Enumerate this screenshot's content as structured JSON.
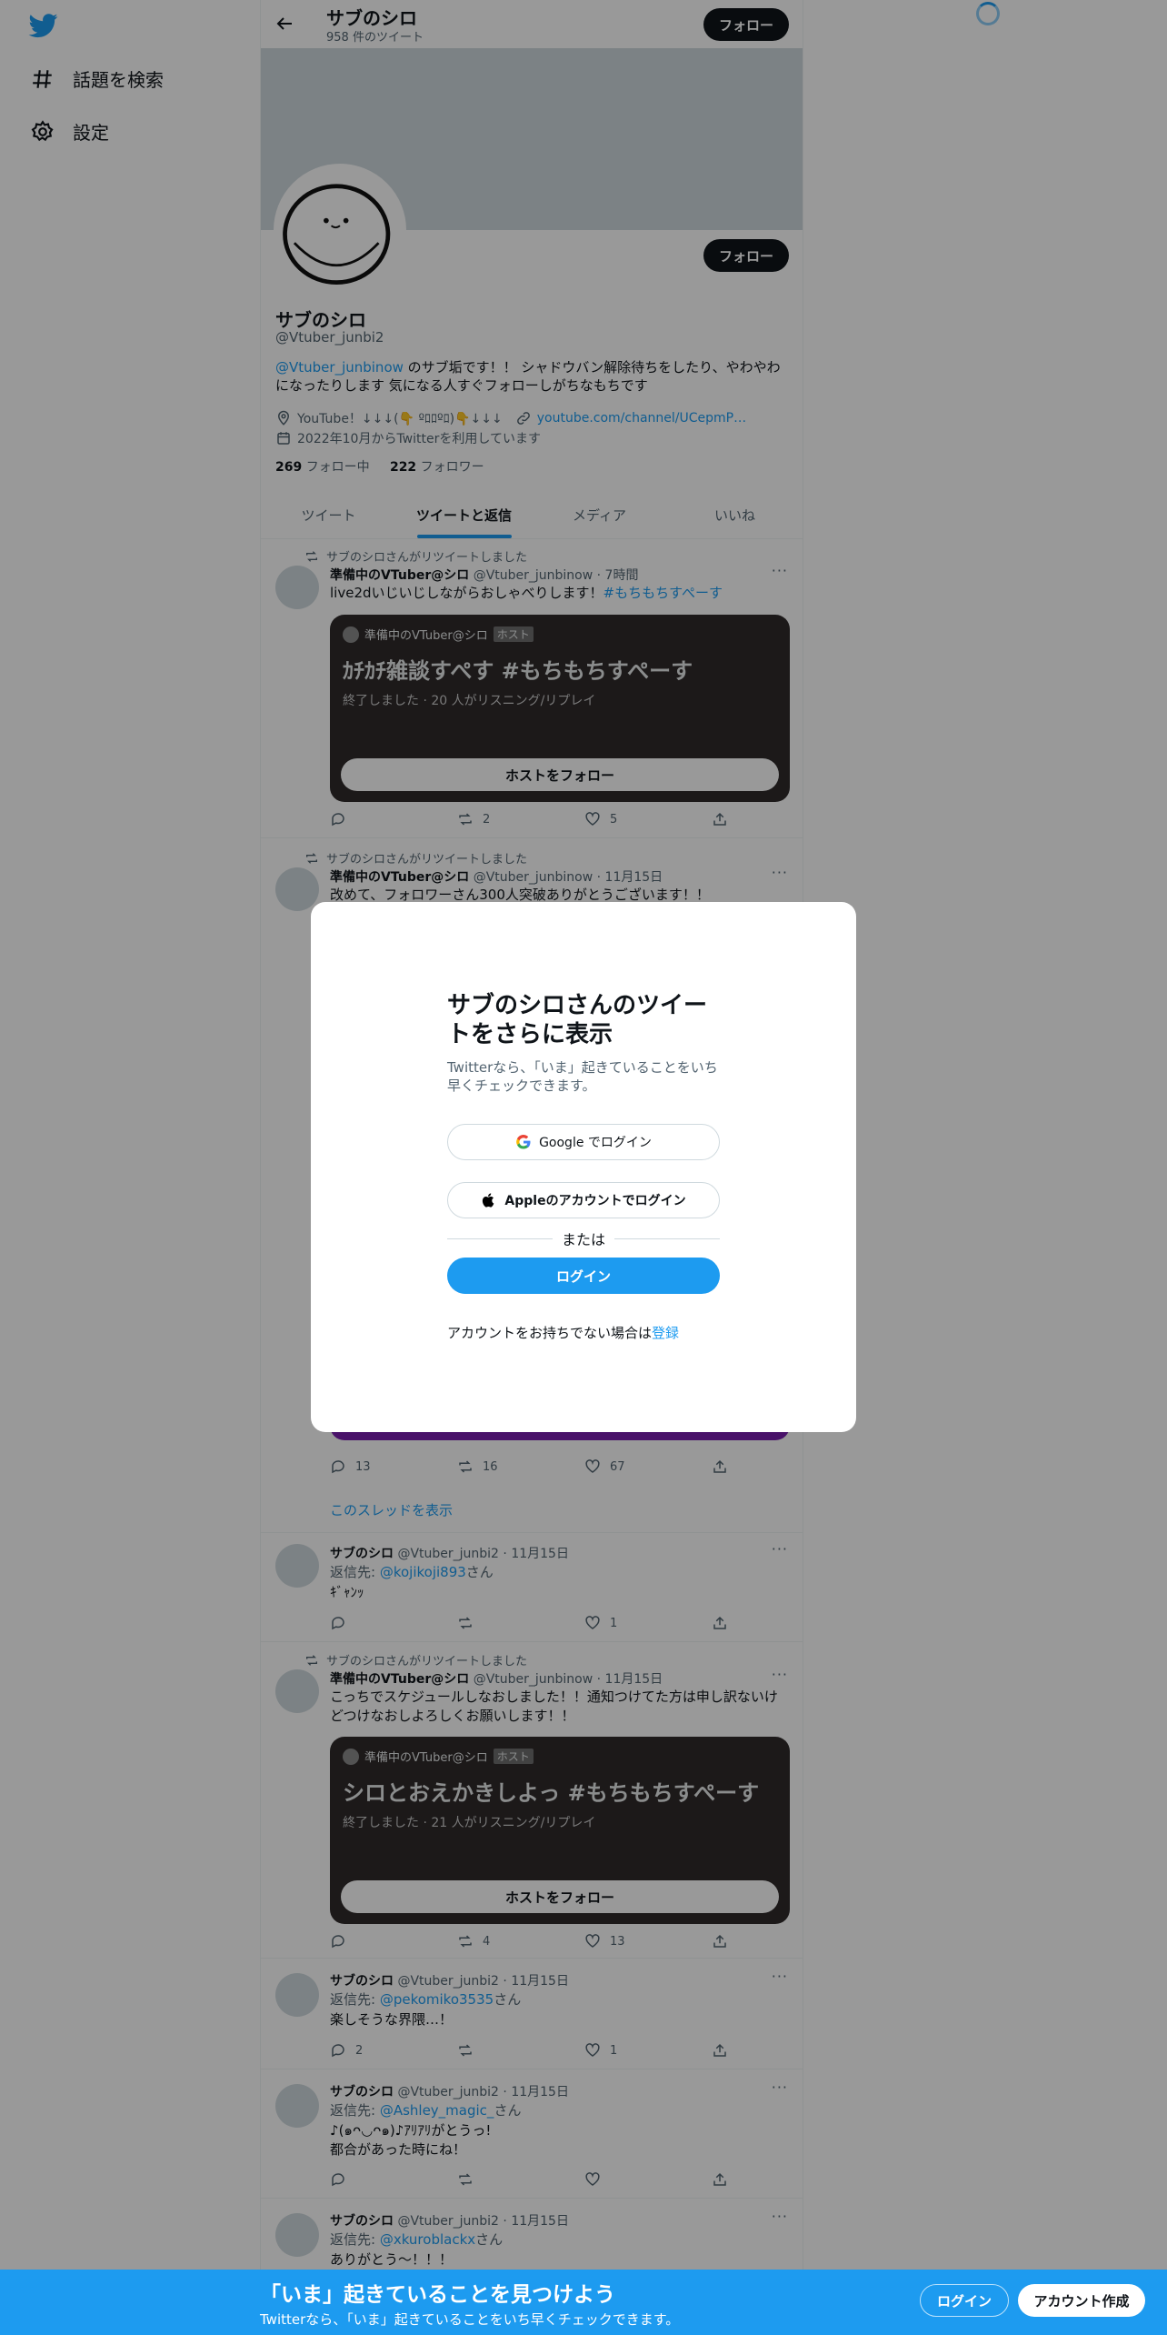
{
  "nav": {
    "explore_label": "話題を検索",
    "settings_label": "設定"
  },
  "header": {
    "title": "サブのシロ",
    "tweet_count": "958 件のツイート",
    "follow_label": "フォロー"
  },
  "profile": {
    "follow_label": "フォロー",
    "name": "サブのシロ",
    "handle": "@Vtuber_junbi2",
    "bio_mention": "@Vtuber_junbinow",
    "bio_text": " のサブ垢です！！ シャドウバン解除待ちをしたり、やわやわになったりします 気になる人すぐフォローしがちなもちです",
    "location": "YouTube！↓↓↓(👇 ︎ºﾛﾛºﾛ)👇↓↓↓",
    "website": "youtube.com/channel/UCepmP…",
    "joined": "2022年10月からTwitterを利用しています",
    "following_count": "269",
    "following_label": "フォロー中",
    "followers_count": "222",
    "followers_label": "フォロワー"
  },
  "tabs": [
    "ツイート",
    "ツイートと返信",
    "メディア",
    "いいね"
  ],
  "tweets": [
    {
      "retweeted_by": "サブのシロさんがリツイートしました",
      "name": "準備中のVTuber@シロ",
      "handle": "@Vtuber_junbinow",
      "time": "7時間",
      "text": "live2dいじいじしながらおしゃべりします！",
      "hashtag": "#もちもちすぺーす",
      "space": {
        "host": "準備中のVTuber@シロ",
        "host_tag": "ホスト",
        "title": "ｶﾁｶﾁ雑談すぺす #もちもちすぺーす",
        "info": "終了しました · 20 人がリスニング/リプレイ",
        "button": "ホストをフォロー"
      },
      "replies": "",
      "retweets": "2",
      "likes": "5"
    },
    {
      "retweeted_by": "サブのシロさんがリツイートしました",
      "name": "準備中のVTuber@シロ",
      "handle": "@Vtuber_junbinow",
      "time": "11月15日",
      "text": "改めて、フォロワーさん300人突破ありがとうございます！！",
      "replies": "13",
      "retweets": "16",
      "likes": "67",
      "thread_label": "このスレッドを表示"
    },
    {
      "name": "サブのシロ",
      "handle": "@Vtuber_junbi2",
      "time": "11月15日",
      "reply_prefix": "返信先: ",
      "reply_to": "@kojikoji893",
      "reply_suffix": "さん",
      "text": "ｷﾞｬﾝｯ",
      "replies": "",
      "retweets": "",
      "likes": "1"
    },
    {
      "retweeted_by": "サブのシロさんがリツイートしました",
      "name": "準備中のVTuber@シロ",
      "handle": "@Vtuber_junbinow",
      "time": "11月15日",
      "text": "こっちでスケジュールしなおしました！！通知つけてた方は申し訳ないけどつけなおしよろしくお願いします！！",
      "space": {
        "host": "準備中のVTuber@シロ",
        "host_tag": "ホスト",
        "title": "シロとおえかきしよっ #もちもちすぺーす",
        "info": "終了しました · 21 人がリスニング/リプレイ",
        "button": "ホストをフォロー"
      },
      "replies": "",
      "retweets": "4",
      "likes": "13"
    },
    {
      "name": "サブのシロ",
      "handle": "@Vtuber_junbi2",
      "time": "11月15日",
      "reply_prefix": "返信先: ",
      "reply_to": "@pekomiko3535",
      "reply_suffix": "さん",
      "text": "楽しそうな界隈…！",
      "replies": "2",
      "retweets": "",
      "likes": "1"
    },
    {
      "name": "サブのシロ",
      "handle": "@Vtuber_junbi2",
      "time": "11月15日",
      "reply_prefix": "返信先: ",
      "reply_to": "@Ashley_magic_",
      "reply_suffix": "さん",
      "text": "♪(๑ᴖ◡ᴖ๑)♪ｱﾘｱﾘがとうっ!\n都合があった時にね！",
      "replies": "",
      "retweets": "",
      "likes": ""
    },
    {
      "name": "サブのシロ",
      "handle": "@Vtuber_junbi2",
      "time": "11月15日",
      "reply_prefix": "返信先: ",
      "reply_to": "@xkuroblackx",
      "reply_suffix": "さん",
      "text": "ありがとう〜！！！"
    }
  ],
  "modal": {
    "title": "サブのシロさんのツイートをさらに表示",
    "subtitle": "Twitterなら、「いま」起きていることをいち早くチェックできます。",
    "google_label": "Google でログイン",
    "apple_label": "Appleのアカウントでログイン",
    "or_label": "または",
    "login_label": "ログイン",
    "signup_prompt": "アカウントをお持ちでない場合は",
    "signup_link": "登録"
  },
  "bottom_bar": {
    "title": "「いま」起きていることを見つけよう",
    "subtitle": "Twitterなら、「いま」起きていることをいち早くチェックできます。",
    "login_label": "ログイン",
    "signup_label": "アカウント作成"
  },
  "colors": {
    "accent": "#1d9bf0",
    "text": "#0f1419",
    "muted": "#536471"
  }
}
